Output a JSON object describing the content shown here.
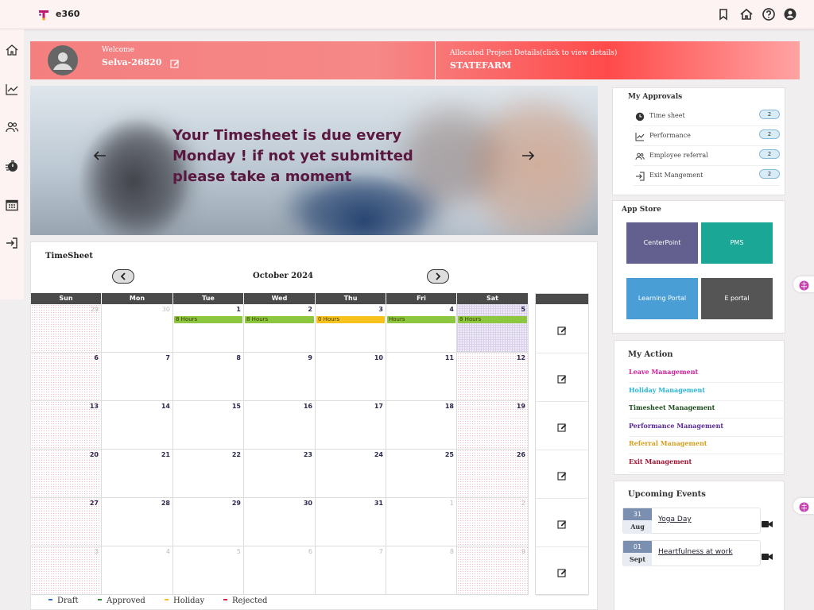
{
  "app": {
    "name": "e360"
  },
  "colors": {
    "accent": "#ff4a4a",
    "approved": "#8dc63f",
    "holiday": "#f7c21d",
    "draft": "#3a6fd8",
    "rejected": "#e02040"
  },
  "topbar": {
    "icons": [
      "bookmark-icon",
      "home-icon",
      "help-icon",
      "account-icon"
    ]
  },
  "sidebar": {
    "icons": [
      "home-icon",
      "chart-icon",
      "people-icon",
      "timer-icon",
      "calendar-icon",
      "exit-icon"
    ]
  },
  "profile": {
    "welcome_label": "Welcome",
    "user_name": "Selva-26820",
    "project_label": "Allocated Project Details(click to view details)",
    "project_name": "STATEFARM"
  },
  "hero": {
    "text": "Your Timesheet is due every Monday ! if not yet submitted please take a moment"
  },
  "timesheet": {
    "title": "TimeSheet",
    "month": "October 2024",
    "weekdays": [
      "Sun",
      "Mon",
      "Tue",
      "Wed",
      "Thu",
      "Fri",
      "Sat"
    ],
    "weeks": [
      [
        {
          "d": "29",
          "m": true
        },
        {
          "d": "30",
          "m": true
        },
        {
          "d": "1",
          "tag": "8 Hours",
          "c": "approved"
        },
        {
          "d": "2",
          "tag": "8 Hours",
          "c": "approved"
        },
        {
          "d": "3",
          "tag": "0 Hours",
          "c": "holiday"
        },
        {
          "d": "4",
          "tag": "Hours",
          "c": "approved"
        },
        {
          "d": "5",
          "tag": "8 Hours",
          "c": "approved",
          "today": true
        }
      ],
      [
        {
          "d": "6"
        },
        {
          "d": "7"
        },
        {
          "d": "8"
        },
        {
          "d": "9"
        },
        {
          "d": "10"
        },
        {
          "d": "11"
        },
        {
          "d": "12"
        }
      ],
      [
        {
          "d": "13"
        },
        {
          "d": "14"
        },
        {
          "d": "15"
        },
        {
          "d": "16"
        },
        {
          "d": "17"
        },
        {
          "d": "18"
        },
        {
          "d": "19"
        }
      ],
      [
        {
          "d": "20"
        },
        {
          "d": "21"
        },
        {
          "d": "22"
        },
        {
          "d": "23"
        },
        {
          "d": "24"
        },
        {
          "d": "25"
        },
        {
          "d": "26"
        }
      ],
      [
        {
          "d": "27"
        },
        {
          "d": "28"
        },
        {
          "d": "29"
        },
        {
          "d": "30"
        },
        {
          "d": "31"
        },
        {
          "d": "1",
          "m": true
        },
        {
          "d": "2",
          "m": true
        }
      ],
      [
        {
          "d": "3",
          "m": true
        },
        {
          "d": "4",
          "m": true
        },
        {
          "d": "5",
          "m": true
        },
        {
          "d": "6",
          "m": true
        },
        {
          "d": "7",
          "m": true
        },
        {
          "d": "8",
          "m": true
        },
        {
          "d": "9",
          "m": true
        }
      ]
    ],
    "legend": [
      {
        "label": "Draft",
        "color": "#3a6fd8"
      },
      {
        "label": "Approved",
        "color": "#2e8b3a"
      },
      {
        "label": "Holiday",
        "color": "#f7c21d"
      },
      {
        "label": "Rejected",
        "color": "#e02040"
      }
    ]
  },
  "approvals": {
    "title": "My Approvals",
    "items": [
      {
        "label": "Time sheet",
        "count": "2",
        "icon": "clock-icon"
      },
      {
        "label": "Performance",
        "count": "2",
        "icon": "chart-icon"
      },
      {
        "label": "Employee referral",
        "count": "2",
        "icon": "people-icon"
      },
      {
        "label": "Exit Mangement",
        "count": "2",
        "icon": "exit-icon"
      }
    ]
  },
  "app_store": {
    "title": "App Store",
    "apps": [
      {
        "label": "CenterPoint",
        "color": "#63608f"
      },
      {
        "label": "PMS",
        "color": "#1aa795"
      },
      {
        "label": "Learning Portal",
        "color": "#4a9ed6"
      },
      {
        "label": "E portal",
        "color": "#555555"
      }
    ]
  },
  "my_action": {
    "title": "My Action",
    "links": [
      {
        "label": "Leave Management",
        "color": "#d0209c"
      },
      {
        "label": "Holiday Management",
        "color": "#2bb5d4"
      },
      {
        "label": "Timesheet Management",
        "color": "#1d4d1d"
      },
      {
        "label": "Performance Management",
        "color": "#5a2a9a"
      },
      {
        "label": "Referral Management",
        "color": "#d4a020"
      },
      {
        "label": "Exit Management",
        "color": "#a01030"
      }
    ]
  },
  "events": {
    "title": "Upcoming Events",
    "items": [
      {
        "day": "31",
        "month": "Aug",
        "name": "Yoga Day"
      },
      {
        "day": "01",
        "month": "Sept",
        "name": "Heartfulness at work"
      }
    ]
  }
}
